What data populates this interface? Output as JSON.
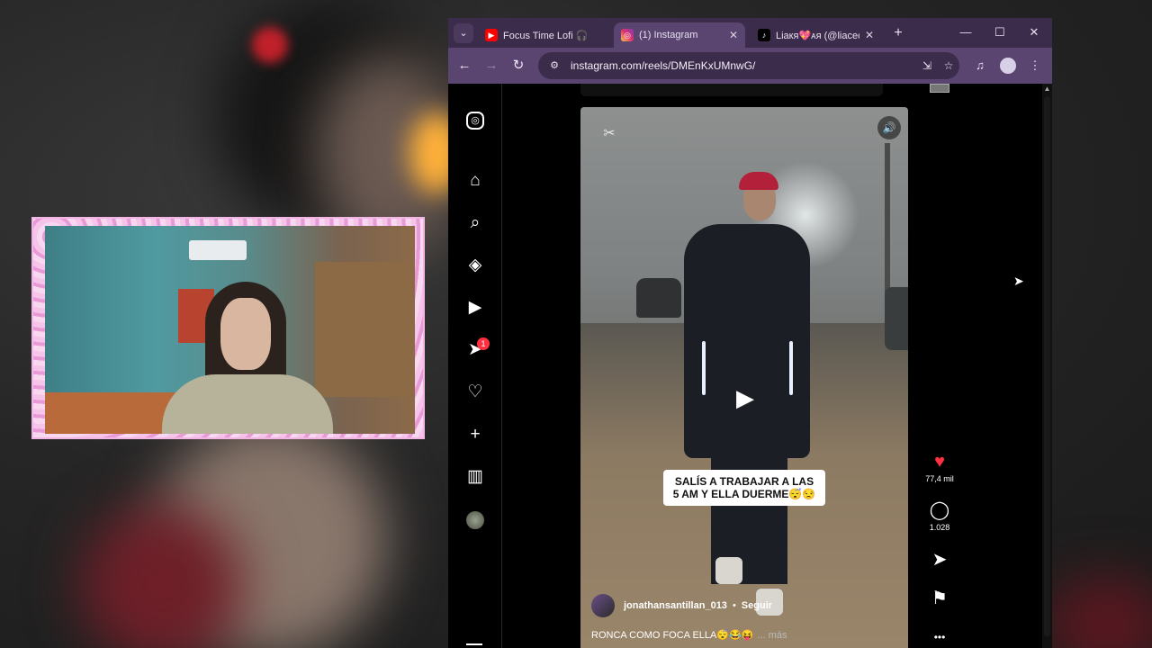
{
  "browser": {
    "tab_menu_icon": "chevron-down-icon",
    "tabs": [
      {
        "title": "Focus Time Lofi 🎧",
        "favicon": "youtube-icon"
      },
      {
        "title": "(1) Instagram",
        "favicon": "instagram-icon"
      },
      {
        "title": "Liaкя💖ᴀя (@liacec…",
        "favicon": "tiktok-icon"
      }
    ],
    "new_tab_icon": "+",
    "window": {
      "minimize": "—",
      "maximize": "☐",
      "close": "✕"
    },
    "toolbar": {
      "back": "←",
      "forward": "→",
      "reload": "↻",
      "url": "instagram.com/reels/DMEnKxUMnwG/",
      "site_info_icon": "⚙",
      "install_icon": "⇲",
      "bookmark_icon": "☆",
      "media_icon": "♫",
      "menu_icon": "⋮"
    }
  },
  "instagram": {
    "sidebar": [
      {
        "name": "instagram-logo-icon",
        "glyph": "◎"
      },
      {
        "name": "home-icon",
        "glyph": "⌂"
      },
      {
        "name": "search-icon",
        "glyph": "⌕"
      },
      {
        "name": "explore-icon",
        "glyph": "◈"
      },
      {
        "name": "reels-icon",
        "glyph": "▶"
      },
      {
        "name": "messages-icon",
        "glyph": "➤"
      },
      {
        "name": "notifications-icon",
        "glyph": "♡"
      },
      {
        "name": "create-icon",
        "glyph": "+"
      },
      {
        "name": "dashboard-icon",
        "glyph": "▥"
      },
      {
        "name": "profile-avatar",
        "glyph": ""
      }
    ],
    "messages_badge": "1",
    "reel": {
      "capcut_icon": "✂",
      "mute_icon": "🔊",
      "play_icon": "▶",
      "caption_lines": [
        "SALÍS A TRABAJAR A LAS",
        "5 AM Y ELLA DUERME😴😒"
      ],
      "author": "jonathansantillan_013",
      "separator": "•",
      "follow_label": "Seguir",
      "description": "RONCA COMO FOCA ELLA😴😂😝",
      "more_label": "... más"
    },
    "actions": {
      "like_icon": "♥",
      "likes": "77,4 mil",
      "comment_icon": "◯",
      "comments": "1.028",
      "share_icon": "➤",
      "save_icon": "⚑",
      "more_icon": "•••"
    }
  },
  "colors": {
    "tab_bar": "#3a2c4a",
    "toolbar": "#5a4470",
    "like_red": "#ff3040",
    "webcam_frame": "#f2b6e4"
  }
}
